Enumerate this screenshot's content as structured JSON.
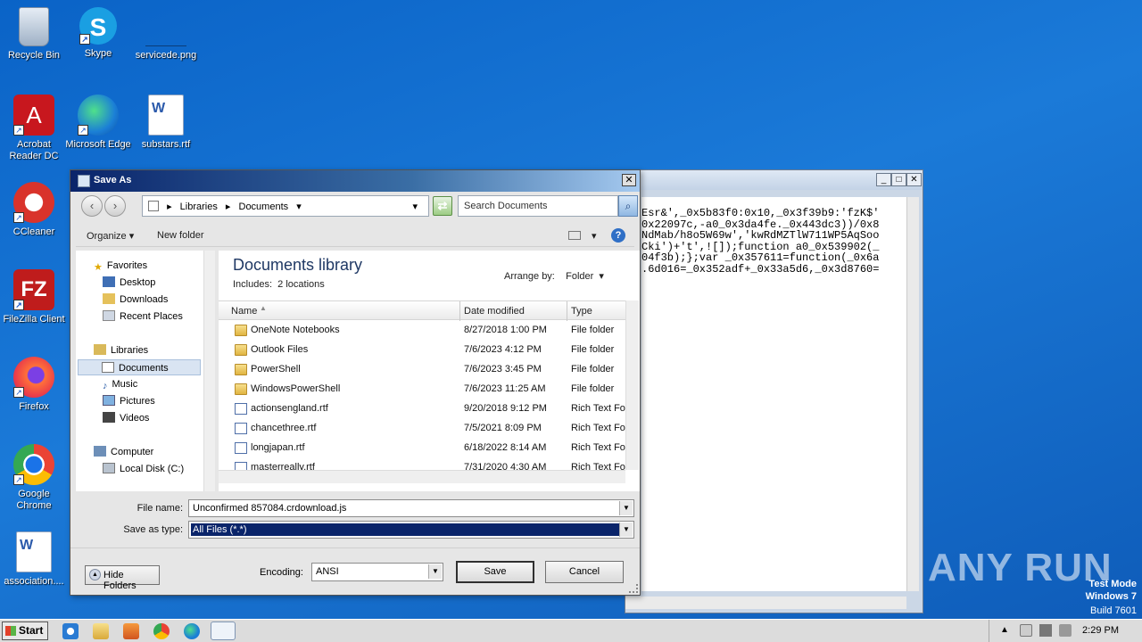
{
  "desktop": {
    "icons": [
      {
        "label": "Recycle Bin",
        "icon": "recycle-bin-icon"
      },
      {
        "label": "Skype",
        "icon": "skype-icon"
      },
      {
        "label": "servicede.png",
        "icon": "image-file-icon"
      },
      {
        "label": "Acrobat Reader DC",
        "icon": "acrobat-icon"
      },
      {
        "label": "Microsoft Edge",
        "icon": "edge-icon"
      },
      {
        "label": "substars.rtf",
        "icon": "word-document-icon"
      },
      {
        "label": "CCleaner",
        "icon": "ccleaner-icon"
      },
      {
        "label": "FileZilla Client",
        "icon": "filezilla-icon"
      },
      {
        "label": "Firefox",
        "icon": "firefox-icon"
      },
      {
        "label": "Google Chrome",
        "icon": "chrome-icon"
      },
      {
        "label": "association....",
        "icon": "word-document-icon"
      }
    ]
  },
  "bg_window": {
    "lines": [
      "Esr&',_0x5b83f0:0x10,_0x3f39b9:'fzK$'",
      "0x22097c,-a0_0x3da4fe._0x443dc3))/0x8",
      "NdMab/h8o5W69w','kwRdMZTlW711WP5AqSoo",
      "Cki')+'t',![]);function a0_0x539902(_",
      "04f3b);};var _0x357611=function(_0x6a",
      ".6d016=_0x352adf+_0x33a5d6,_0x3d8760="
    ]
  },
  "dialog": {
    "title": "Save As",
    "address": {
      "crumbs": [
        "Libraries",
        "Documents"
      ]
    },
    "search_placeholder": "Search Documents",
    "toolbar": {
      "organize": "Organize",
      "new_folder": "New folder"
    },
    "nav": {
      "favorites": "Favorites",
      "desktop": "Desktop",
      "downloads": "Downloads",
      "recent": "Recent Places",
      "libraries": "Libraries",
      "documents": "Documents",
      "music": "Music",
      "pictures": "Pictures",
      "videos": "Videos",
      "computer": "Computer",
      "local_disk": "Local Disk (C:)"
    },
    "library": {
      "title": "Documents library",
      "includes_label": "Includes:",
      "includes_value": "2 locations",
      "arrange_label": "Arrange by:",
      "arrange_value": "Folder"
    },
    "columns": {
      "name": "Name",
      "date": "Date modified",
      "type": "Type"
    },
    "files": [
      {
        "name": "OneNote Notebooks",
        "date": "8/27/2018 1:00 PM",
        "type": "File folder",
        "kind": "folder"
      },
      {
        "name": "Outlook Files",
        "date": "7/6/2023 4:12 PM",
        "type": "File folder",
        "kind": "folder"
      },
      {
        "name": "PowerShell",
        "date": "7/6/2023 3:45 PM",
        "type": "File folder",
        "kind": "folder"
      },
      {
        "name": "WindowsPowerShell",
        "date": "7/6/2023 11:25 AM",
        "type": "File folder",
        "kind": "folder"
      },
      {
        "name": "actionsengland.rtf",
        "date": "9/20/2018 9:12 PM",
        "type": "Rich Text Fo",
        "kind": "rtf"
      },
      {
        "name": "chancethree.rtf",
        "date": "7/5/2021 8:09 PM",
        "type": "Rich Text Fo",
        "kind": "rtf"
      },
      {
        "name": "longjapan.rtf",
        "date": "6/18/2022 8:14 AM",
        "type": "Rich Text Fo",
        "kind": "rtf"
      },
      {
        "name": "masterreally.rtf",
        "date": "7/31/2020 4:30 AM",
        "type": "Rich Text Fo",
        "kind": "rtf"
      }
    ],
    "file_name_label": "File name:",
    "file_name_value": "Unconfirmed 857084.crdownload.js",
    "save_type_label": "Save as type:",
    "save_type_value": "All Files  (*.*)",
    "hide_folders": "Hide Folders",
    "encoding_label": "Encoding:",
    "encoding_value": "ANSI",
    "save": "Save",
    "cancel": "Cancel"
  },
  "watermark": "ANY RUN",
  "test_mode": {
    "line1": "Test Mode",
    "line2": "Windows 7",
    "line3": "Build 7601"
  },
  "taskbar": {
    "start": "Start",
    "clock": "2:29 PM"
  }
}
